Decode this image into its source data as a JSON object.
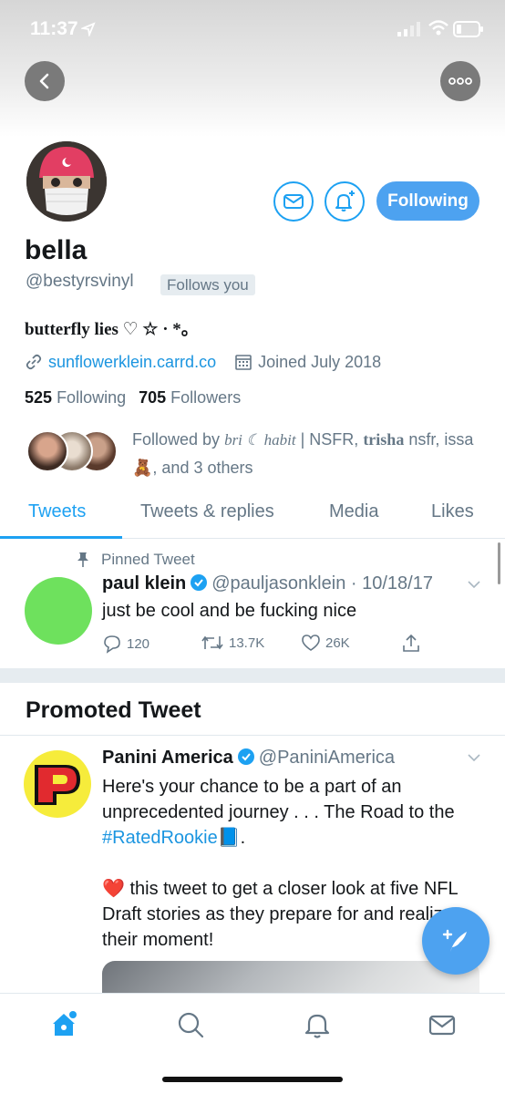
{
  "status_bar": {
    "time": "11:37"
  },
  "profile": {
    "display_name": "bella",
    "handle": "@bestyrsvinyl",
    "follows_you": "Follows you",
    "following_button": "Following",
    "bio_main": "butterfly lies ♡ ☆ · *。",
    "website": "sunflowerklein.carrd.co",
    "joined": "Joined July 2018",
    "following_count": "525",
    "following_label": "Following",
    "followers_count": "705",
    "followers_label": "Followers",
    "followed_by_prefix": "Followed by",
    "followed_by_name1": "bri ☾ habit",
    "followed_by_mid": "| NSFR,",
    "followed_by_name2": "trisha",
    "followed_by_mid2": "nsfr,",
    "followed_by_name3": "issa 🧸",
    "followed_by_suffix": ", and 3 others"
  },
  "tabs": [
    "Tweets",
    "Tweets & replies",
    "Media",
    "Likes"
  ],
  "pinned_tweet": {
    "label": "Pinned Tweet",
    "name": "paul klein",
    "handle_date": "@pauljasonklein · 10/18/17",
    "text": "just be cool and be fucking nice",
    "replies": "120",
    "retweets": "13.7K",
    "likes": "26K"
  },
  "promoted": {
    "title": "Promoted Tweet",
    "name": "Panini America",
    "handle": "@PaniniAmerica",
    "text_1": "Here's your chance to be a part of an unprecedented journey . . . The Road to the",
    "hashtag": "#RatedRookie",
    "text_1_end": "📘.",
    "text_2": "❤️ this tweet to get a closer look at five NFL Draft stories as they prepare for and realize their moment!"
  },
  "colors": {
    "accent": "#1da1f2",
    "button": "#4da2f0",
    "muted": "#657786",
    "pinned_avatar": "#6ee15d"
  },
  "icons": [
    "back-icon",
    "more-icon",
    "mail-icon",
    "bell-plus-icon",
    "link-icon",
    "calendar-icon",
    "pin-icon",
    "verified-icon",
    "chevron-down-icon",
    "reply-icon",
    "retweet-icon",
    "like-icon",
    "share-icon",
    "compose-icon",
    "home-icon",
    "search-icon",
    "notifications-icon",
    "messages-icon"
  ]
}
